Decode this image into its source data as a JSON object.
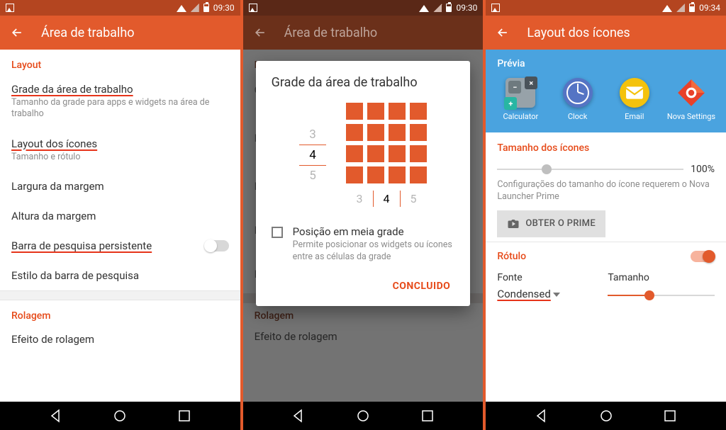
{
  "status": {
    "time_a": "09:30",
    "time_b": "09:30",
    "time_c": "09:34"
  },
  "screen1": {
    "title": "Área de trabalho",
    "section_layout": "Layout",
    "items": {
      "grade": {
        "title": "Grade da área de trabalho",
        "sub": "Tamanho da grade para apps e widgets na área de trabalho"
      },
      "icones": {
        "title": "Layout dos ícones",
        "sub": "Tamanho e rótulo"
      },
      "largura": {
        "title": "Largura da margem"
      },
      "altura": {
        "title": "Altura da margem"
      },
      "barra": {
        "title": "Barra de pesquisa persistente"
      },
      "estilo": {
        "title": "Estilo da barra de pesquisa"
      }
    },
    "section_rolagem": "Rolagem",
    "rolagem_item": "Efeito de rolagem"
  },
  "screen2": {
    "title_bar": "Área de trabalho",
    "dialog": {
      "title": "Grade da área de trabalho",
      "rows_options": [
        "3",
        "4",
        "5"
      ],
      "rows_selected": "4",
      "cols_options": [
        "3",
        "4",
        "5"
      ],
      "cols_selected": "4",
      "half_title": "Posição em meia grade",
      "half_sub": "Permite posicionar os widgets ou ícones entre as células da grade",
      "done": "CONCLUIDO"
    },
    "bg_items": {
      "efeito": "Efeito de rolagem",
      "section_rolagem": "Rolagem"
    }
  },
  "screen3": {
    "title": "Layout dos ícones",
    "preview_label": "Prévia",
    "apps": [
      {
        "name": "Calculator"
      },
      {
        "name": "Clock"
      },
      {
        "name": "Email"
      },
      {
        "name": "Nova Settings"
      }
    ],
    "icon_size": {
      "header": "Tamanho dos ícones",
      "value": "100%",
      "note": "Configurações do tamanho do ícone requerem o Nova Launcher Prime",
      "prime_btn": "OBTER O PRIME"
    },
    "rotulo": {
      "header": "Rótulo",
      "font_label": "Fonte",
      "size_label": "Tamanho",
      "font_value": "Condensed"
    }
  }
}
